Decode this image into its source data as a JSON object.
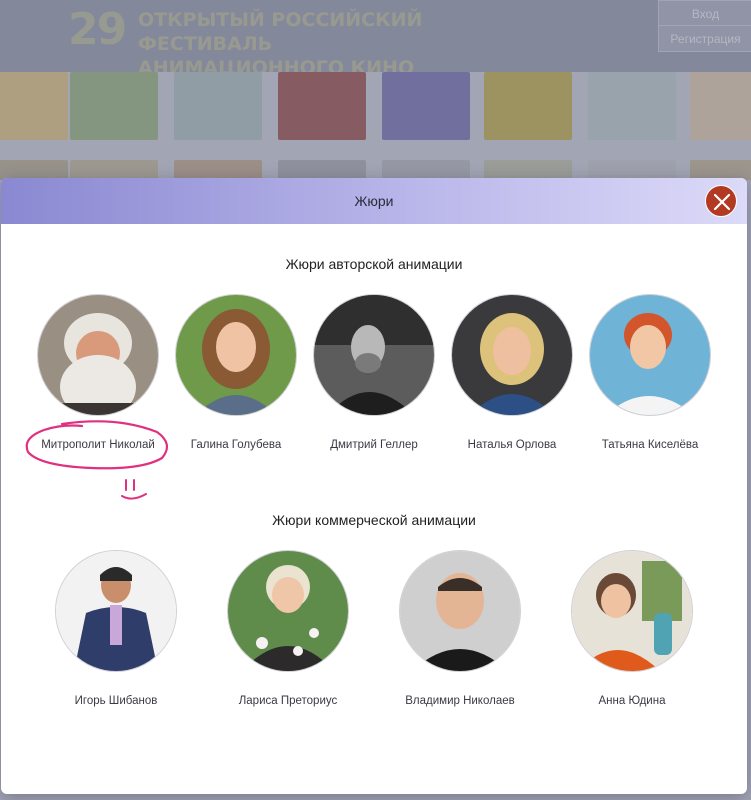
{
  "site": {
    "festival_number": "29",
    "festival_title_line1": "ОТКРЫТЫЙ РОССИЙСКИЙ ФЕСТИВАЛЬ",
    "festival_title_line2": "АНИМАЦИОННОГО КИНО",
    "login_label": "Вход",
    "register_label": "Регистрация"
  },
  "modal": {
    "title": "Жюри",
    "close_icon": "close-icon",
    "sections": [
      {
        "title": "Жюри авторской анимации",
        "members": [
          {
            "name": "Митрополит Николай"
          },
          {
            "name": "Галина Голубева"
          },
          {
            "name": "Дмитрий Геллер"
          },
          {
            "name": "Наталья Орлова"
          },
          {
            "name": "Татьяна Киселёва"
          }
        ]
      },
      {
        "title": "Жюри коммерческой анимации",
        "members": [
          {
            "name": "Игорь Шибанов"
          },
          {
            "name": "Лариса Преториус"
          },
          {
            "name": "Владимир Николаев"
          },
          {
            "name": "Анна Юдина"
          }
        ]
      }
    ]
  },
  "colors": {
    "accent_close": "#b23a22",
    "header_gradient_start": "#8a88d1",
    "annotation_pink": "#e0307f"
  }
}
